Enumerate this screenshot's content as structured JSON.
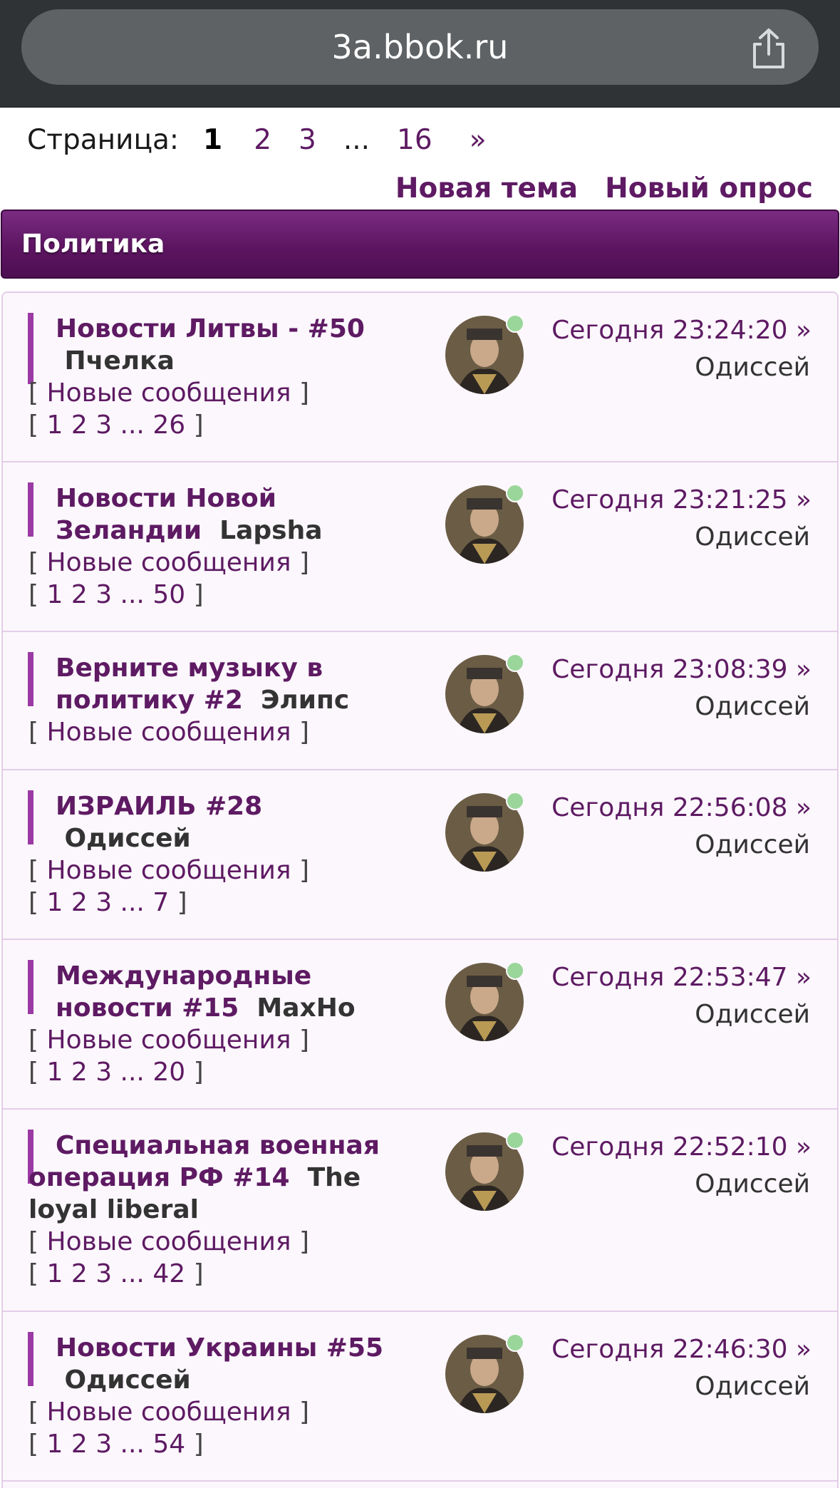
{
  "browser": {
    "url": "3a.bbok.ru"
  },
  "pager": {
    "label": "Страница:",
    "current": "1",
    "page2": "2",
    "page3": "3",
    "dots": "...",
    "last": "16",
    "next": "»"
  },
  "actions": {
    "new_topic": "Новая тема",
    "new_poll": "Новый опрос"
  },
  "forum": {
    "title": "Политика"
  },
  "topics": [
    {
      "title": "Новости Литвы - #50",
      "author": "Пчелка",
      "new_label": "Новые сообщения",
      "pages": "1 2 3 ... 26",
      "time": "Сегодня 23:24:20 »",
      "last_user": "Одиссей"
    },
    {
      "title": "Новости Новой Зеландии",
      "author": "Lapsha",
      "new_label": "Новые сообщения",
      "pages": "1 2 3 ... 50",
      "time": "Сегодня 23:21:25 »",
      "last_user": "Одиссей"
    },
    {
      "title": "Верните музыку в политику #2",
      "author": "Элипс",
      "new_label": "Новые сообщения",
      "pages": "",
      "time": "Сегодня 23:08:39 »",
      "last_user": "Одиссей"
    },
    {
      "title": "ИЗРАИЛЬ #28",
      "author": "Одиссей",
      "new_label": "Новые сообщения",
      "pages": "1 2 3 ... 7",
      "time": "Сегодня 22:56:08 »",
      "last_user": "Одиссей"
    },
    {
      "title": "Международные новости #15",
      "author": "MaxHo",
      "new_label": "Новые сообщения",
      "pages": "1 2 3 ... 20",
      "time": "Сегодня 22:53:47 »",
      "last_user": "Одиссей"
    },
    {
      "title": "Специальная военная операция РФ #14",
      "author": "The loyal liberal",
      "new_label": "Новые сообщения",
      "pages": "1 2 3 ... 42",
      "time": "Сегодня 22:52:10 »",
      "last_user": "Одиссей"
    },
    {
      "title": "Новости Украины #55",
      "author": "Одиссей",
      "new_label": "Новые сообщения",
      "pages": "1 2 3 ... 54",
      "time": "Сегодня 22:46:30 »",
      "last_user": "Одиссей"
    }
  ],
  "icons": {
    "share": "share-icon",
    "avatar": "avatar-portrait"
  },
  "colors": {
    "accent": "#5e1a63",
    "header_bar": "#5d1561",
    "row_bg": "#fbf7fc",
    "online": "#9ad69a"
  }
}
